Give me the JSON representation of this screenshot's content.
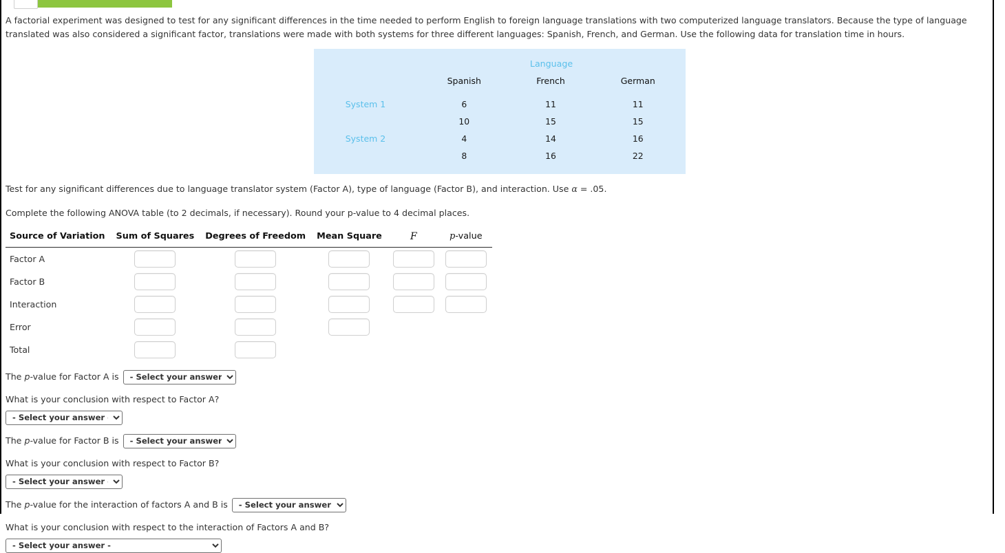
{
  "topbar": {
    "icon": "document-icon",
    "progress_color": "#8dc63f"
  },
  "prompt": {
    "text": "A factorial experiment was designed to test for any significant differences in the time needed to perform English to foreign language translations with two computerized language translators. Because the type of language translated was also considered a significant factor, translations were made with both systems for three different languages: Spanish, French, and German. Use the following data for translation time in hours."
  },
  "data_table": {
    "group_header": "Language",
    "column_headers": [
      "Spanish",
      "French",
      "German"
    ],
    "rows": [
      {
        "label": "System 1",
        "values": [
          "6",
          "11",
          "11"
        ]
      },
      {
        "label": "",
        "values": [
          "10",
          "15",
          "15"
        ]
      },
      {
        "label": "System 2",
        "values": [
          "4",
          "14",
          "16"
        ]
      },
      {
        "label": "",
        "values": [
          "8",
          "16",
          "22"
        ]
      }
    ],
    "bg_color": "#d9ecfb",
    "label_color": "#5bc0eb"
  },
  "instructions": {
    "line1_a": "Test for any significant differences due to language translator system (Factor A), type of language (Factor B), and interaction. Use ",
    "line1_alpha": "α",
    "line1_b": " = .05",
    "line1_c": ".",
    "line2": "Complete the following ANOVA table (to 2 decimals, if necessary). Round your p-value to 4 decimal places."
  },
  "anova": {
    "headers": {
      "source": "Source of Variation",
      "sum_of_squares": "Sum of Squares",
      "degrees_of_freedom": "Degrees of Freedom",
      "mean_square": "Mean Square",
      "f": "F",
      "p_value_prefix": "p",
      "p_value_suffix": "-value"
    },
    "rows": [
      {
        "label": "Factor A",
        "inputs": 5,
        "values": [
          "",
          "",
          "",
          "",
          ""
        ]
      },
      {
        "label": "Factor B",
        "inputs": 5,
        "values": [
          "",
          "",
          "",
          "",
          ""
        ]
      },
      {
        "label": "Interaction",
        "inputs": 5,
        "values": [
          "",
          "",
          "",
          "",
          ""
        ]
      },
      {
        "label": "Error",
        "inputs": 3,
        "values": [
          "",
          "",
          ""
        ]
      },
      {
        "label": "Total",
        "inputs": 2,
        "values": [
          "",
          ""
        ]
      }
    ]
  },
  "questions": {
    "select_placeholder": "- Select your answer -",
    "pval_a_prefix": "The ",
    "pval_a_italic": "p",
    "pval_a_suffix": "-value for Factor A is",
    "concl_a": "What is your conclusion with respect to Factor A?",
    "pval_b_prefix": "The ",
    "pval_b_italic": "p",
    "pval_b_suffix": "-value for Factor B is",
    "concl_b": "What is your conclusion with respect to Factor B?",
    "pval_ab_prefix": "The ",
    "pval_ab_italic": "p",
    "pval_ab_suffix": "-value for the interaction of factors A and B is",
    "concl_ab": "What is your conclusion with respect to the interaction of Factors A and B?"
  }
}
